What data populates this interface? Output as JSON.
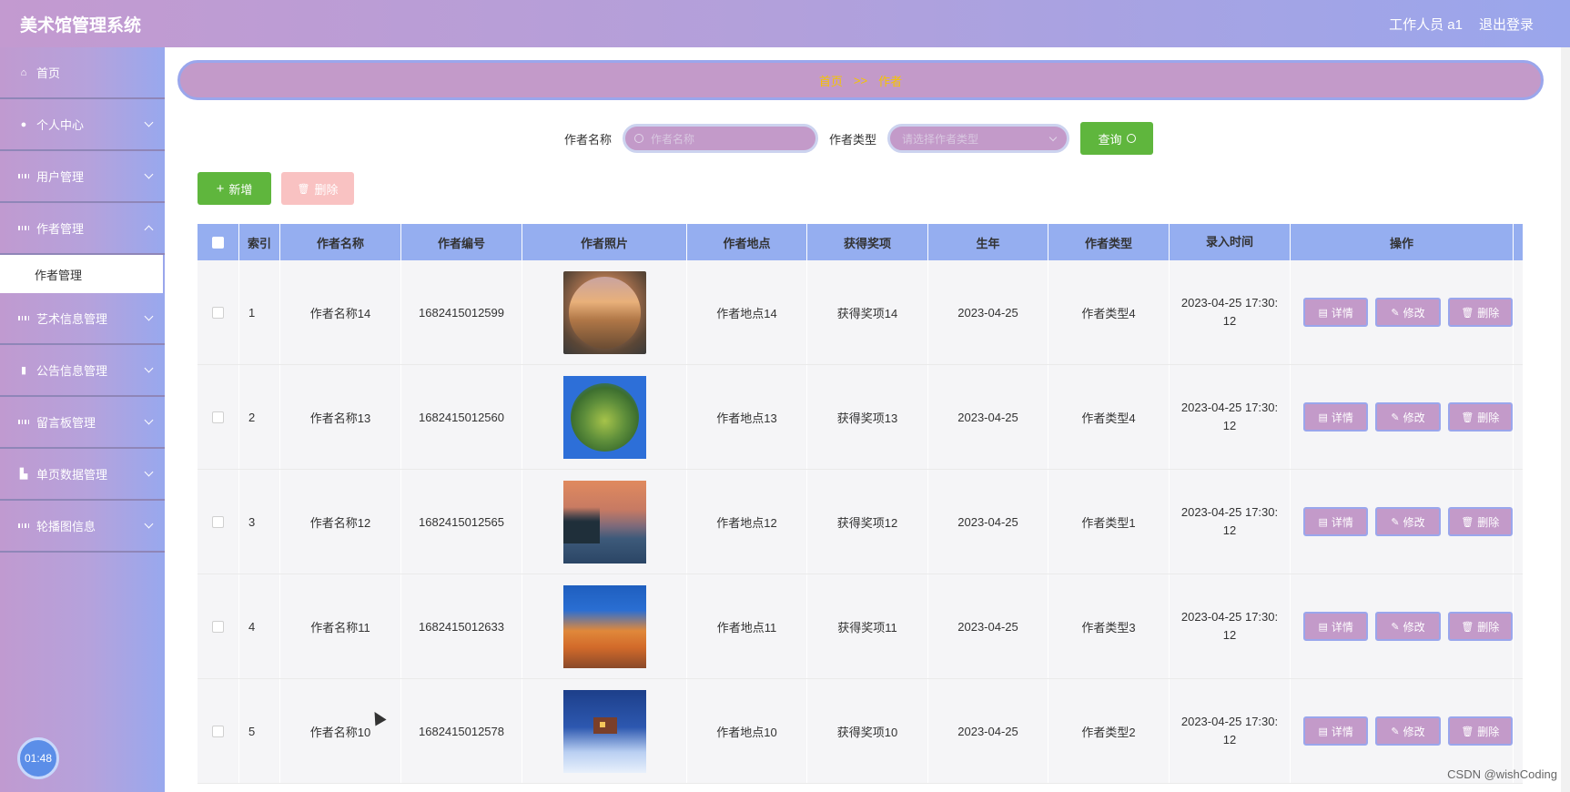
{
  "app": {
    "title": "美术馆管理系统"
  },
  "header": {
    "user": "工作人员 a1",
    "logout": "退出登录"
  },
  "sidebar": {
    "items": [
      {
        "label": "首页",
        "icon": "home-icon"
      },
      {
        "label": "个人中心",
        "icon": "user-icon"
      },
      {
        "label": "用户管理",
        "icon": "grid-icon"
      },
      {
        "label": "作者管理",
        "icon": "grid-icon",
        "sub": "作者管理"
      },
      {
        "label": "艺术信息管理",
        "icon": "grid-icon"
      },
      {
        "label": "公告信息管理",
        "icon": "bar-chart-icon"
      },
      {
        "label": "留言板管理",
        "icon": "grid-icon"
      },
      {
        "label": "单页数据管理",
        "icon": "stamp-icon"
      },
      {
        "label": "轮播图信息",
        "icon": "grid-icon"
      }
    ],
    "clock": "01:48"
  },
  "breadcrumb": {
    "home": "首页",
    "sep": ">>",
    "current": "作者"
  },
  "search": {
    "name_label": "作者名称",
    "name_placeholder": "作者名称",
    "type_label": "作者类型",
    "type_placeholder": "请选择作者类型",
    "query": "查询"
  },
  "toolbar": {
    "add": "新增",
    "delete": "删除"
  },
  "table": {
    "headers": [
      "索引",
      "作者名称",
      "作者编号",
      "作者照片",
      "作者地点",
      "获得奖项",
      "生年",
      "作者类型",
      "录入时间",
      "操作"
    ],
    "rows": [
      {
        "idx": "1",
        "name": "作者名称14",
        "no": "1682415012599",
        "loc": "作者地点14",
        "award": "获得奖项14",
        "year": "2023-04-25",
        "type": "作者类型4",
        "time1": "2023-04-25 17:30:",
        "time2": "12"
      },
      {
        "idx": "2",
        "name": "作者名称13",
        "no": "1682415012560",
        "loc": "作者地点13",
        "award": "获得奖项13",
        "year": "2023-04-25",
        "type": "作者类型4",
        "time1": "2023-04-25 17:30:",
        "time2": "12"
      },
      {
        "idx": "3",
        "name": "作者名称12",
        "no": "1682415012565",
        "loc": "作者地点12",
        "award": "获得奖项12",
        "year": "2023-04-25",
        "type": "作者类型1",
        "time1": "2023-04-25 17:30:",
        "time2": "12"
      },
      {
        "idx": "4",
        "name": "作者名称11",
        "no": "1682415012633",
        "loc": "作者地点11",
        "award": "获得奖项11",
        "year": "2023-04-25",
        "type": "作者类型3",
        "time1": "2023-04-25 17:30:",
        "time2": "12"
      },
      {
        "idx": "5",
        "name": "作者名称10",
        "no": "1682415012578",
        "loc": "作者地点10",
        "award": "获得奖项10",
        "year": "2023-04-25",
        "type": "作者类型2",
        "time1": "2023-04-25 17:30:",
        "time2": "12"
      }
    ],
    "ops": {
      "detail": "详情",
      "edit": "修改",
      "delete": "删除"
    }
  },
  "watermark": "CSDN @wishCoding"
}
